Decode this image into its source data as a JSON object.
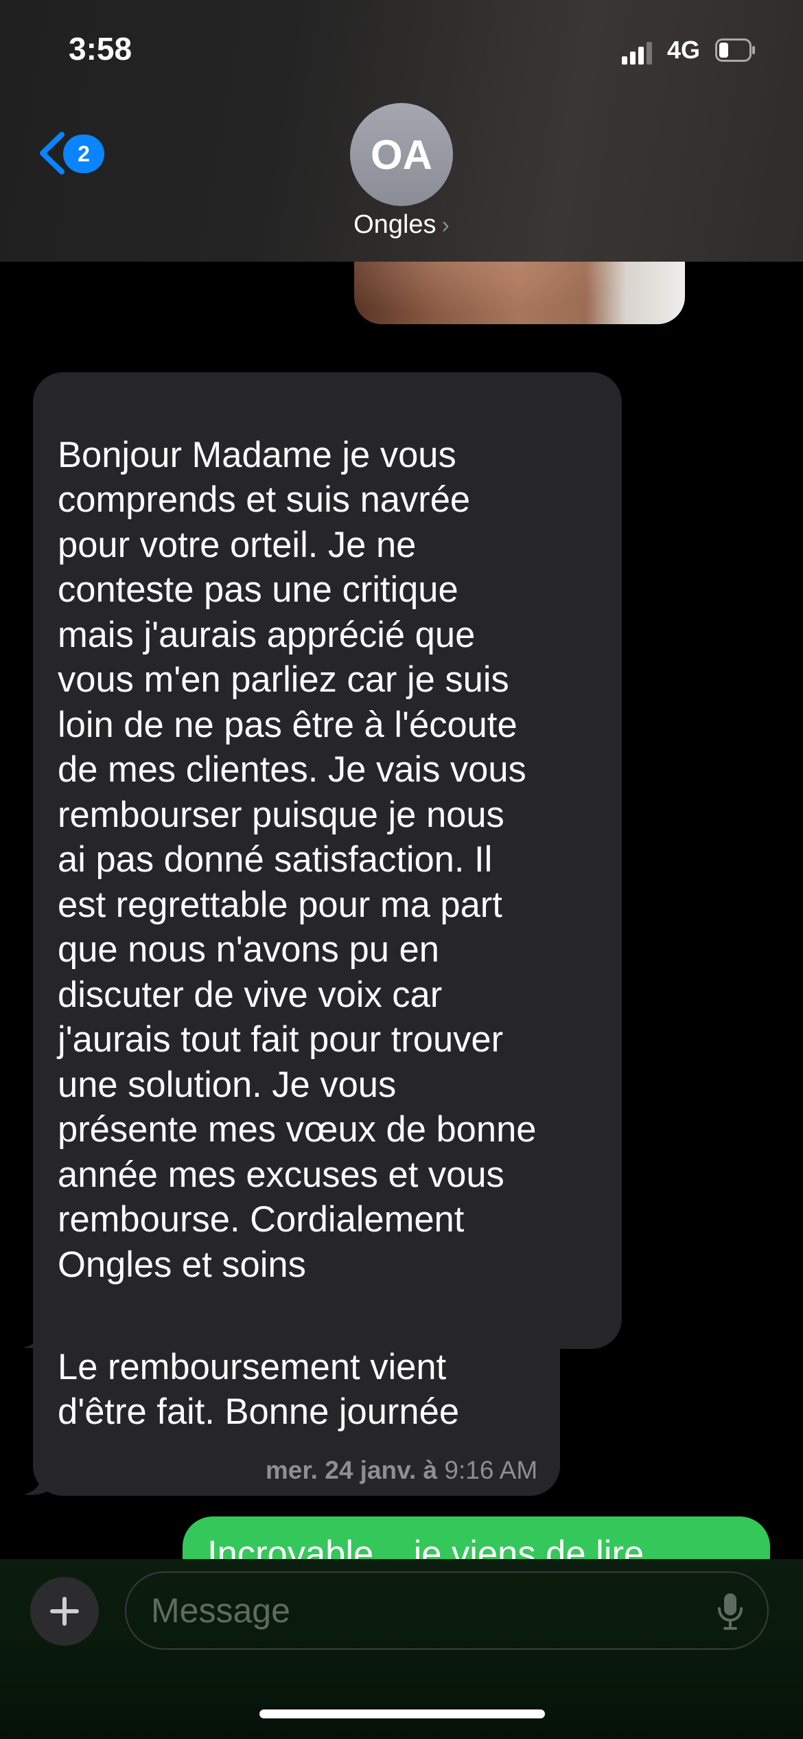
{
  "status_bar": {
    "time": "3:58",
    "network": "4G"
  },
  "header": {
    "back_badge": "2",
    "avatar_initials": "OA",
    "contact_name": "Ongles",
    "contact_chevron": "›"
  },
  "messages": [
    {
      "direction": "incoming",
      "text": "Bonjour Madame je vous\ncomprends et suis navrée\npour votre orteil. Je ne\nconteste pas une critique\nmais j'aurais apprécié que\nvous m'en parliez car je suis\nloin de ne pas être à l'écoute\nde mes clientes. Je vais vous\nrembourser puisque je nous\nai pas donné satisfaction. Il\nest regrettable pour ma part\nque nous n'avons pu en\ndiscuter de vive voix car\nj'aurais tout fait pour trouver\nune solution. Je vous\nprésente mes vœux de bonne\nannée mes excuses et vous\nrembourse.  Cordialement\nOngles et soins"
    },
    {
      "direction": "incoming",
      "text": "Le remboursement vient\nd'être fait.  Bonne journée"
    },
    {
      "direction": "outgoing",
      "text": "Incroyable... je viens de lire"
    }
  ],
  "timestamp": {
    "date": "mer. 24 janv. à",
    "time": "9:16 AM"
  },
  "composer": {
    "placeholder": "Message"
  },
  "icons": {
    "back": "chevron-left-icon",
    "plus": "plus-icon",
    "mic": "microphone-icon",
    "battery": "battery-icon",
    "signal": "signal-icon"
  },
  "colors": {
    "incoming_bubble": "#262628",
    "outgoing_bubble": "#34c759",
    "accent": "#0a84ff"
  }
}
